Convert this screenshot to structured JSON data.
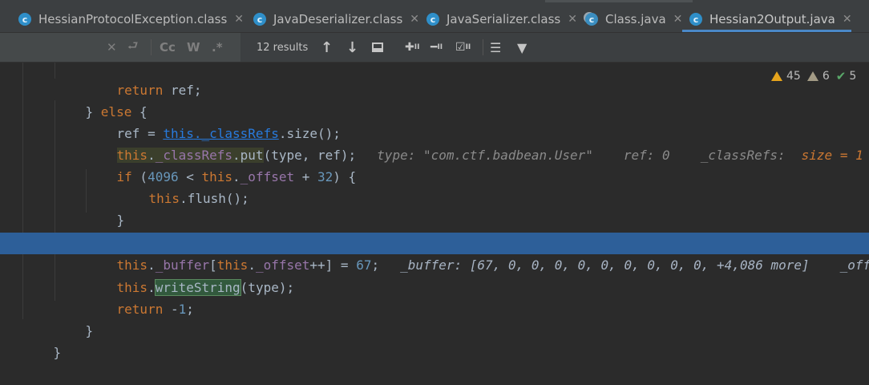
{
  "tabs": [
    {
      "label": "HessianProtocolException.class",
      "icon": "class-file-icon"
    },
    {
      "label": "JavaDeserializer.class",
      "icon": "class-file-icon"
    },
    {
      "label": "JavaSerializer.class",
      "icon": "class-file-icon"
    },
    {
      "label": "Class.java",
      "icon": "java-file-icon"
    },
    {
      "label": "Hessian2Output.java",
      "icon": "class-file-icon",
      "active": true
    }
  ],
  "find": {
    "query": "",
    "match_case_label": "Cc",
    "words_label": "W",
    "regex_label": ".*",
    "results": "12 results"
  },
  "inspections": {
    "warnings": "45",
    "weak_warnings": "6",
    "ok": "5"
  },
  "code": {
    "l1": {
      "kw": "return",
      "rest": " ref;"
    },
    "l2": {
      "brace": "} ",
      "kw": "else",
      "rest": " {"
    },
    "l3": {
      "a": "ref = ",
      "this": "this",
      "dot": ".",
      "field": "_classRefs",
      "b": ".size();"
    },
    "l4": {
      "this": "this",
      "dot": ".",
      "field": "_classRefs",
      "dot2": ".",
      "put": "put",
      "b": "(type, ref);",
      "hint1": "type: \"com.ctf.badbean.User\"",
      "hint2": "ref: 0",
      "hint3": "_classRefs:",
      "hint3v": "size = 1"
    },
    "l5": {
      "kw": "if",
      "a": " (",
      "n1": "4096",
      "b": " < ",
      "this": "this",
      "dot": ".",
      "field": "_offset",
      "c": " + ",
      "n2": "32",
      "d": ") {"
    },
    "l6": {
      "this": "this",
      "b": ".flush();"
    },
    "l7": {
      "b": "}"
    },
    "l8": {
      "this": "this",
      "dot": ".",
      "field": "_buffer",
      "b": "[",
      "this2": "this",
      "dot2": ".",
      "field2": "_offset",
      "c": "++] = ",
      "n": "67",
      "d": ";",
      "hint1": "_buffer: [67, 0, 0, 0, 0, 0, 0, 0, 0, 0, +4,086 more]",
      "hint2": "_offs"
    },
    "l9": {
      "this": "this",
      "dot": ".",
      "call": "writeString",
      "b": "(type);"
    },
    "l10": {
      "kw": "return",
      "b": " -",
      "n": "1",
      "c": ";"
    },
    "l11": {
      "b": "}"
    },
    "l12": {
      "b": "}"
    }
  }
}
